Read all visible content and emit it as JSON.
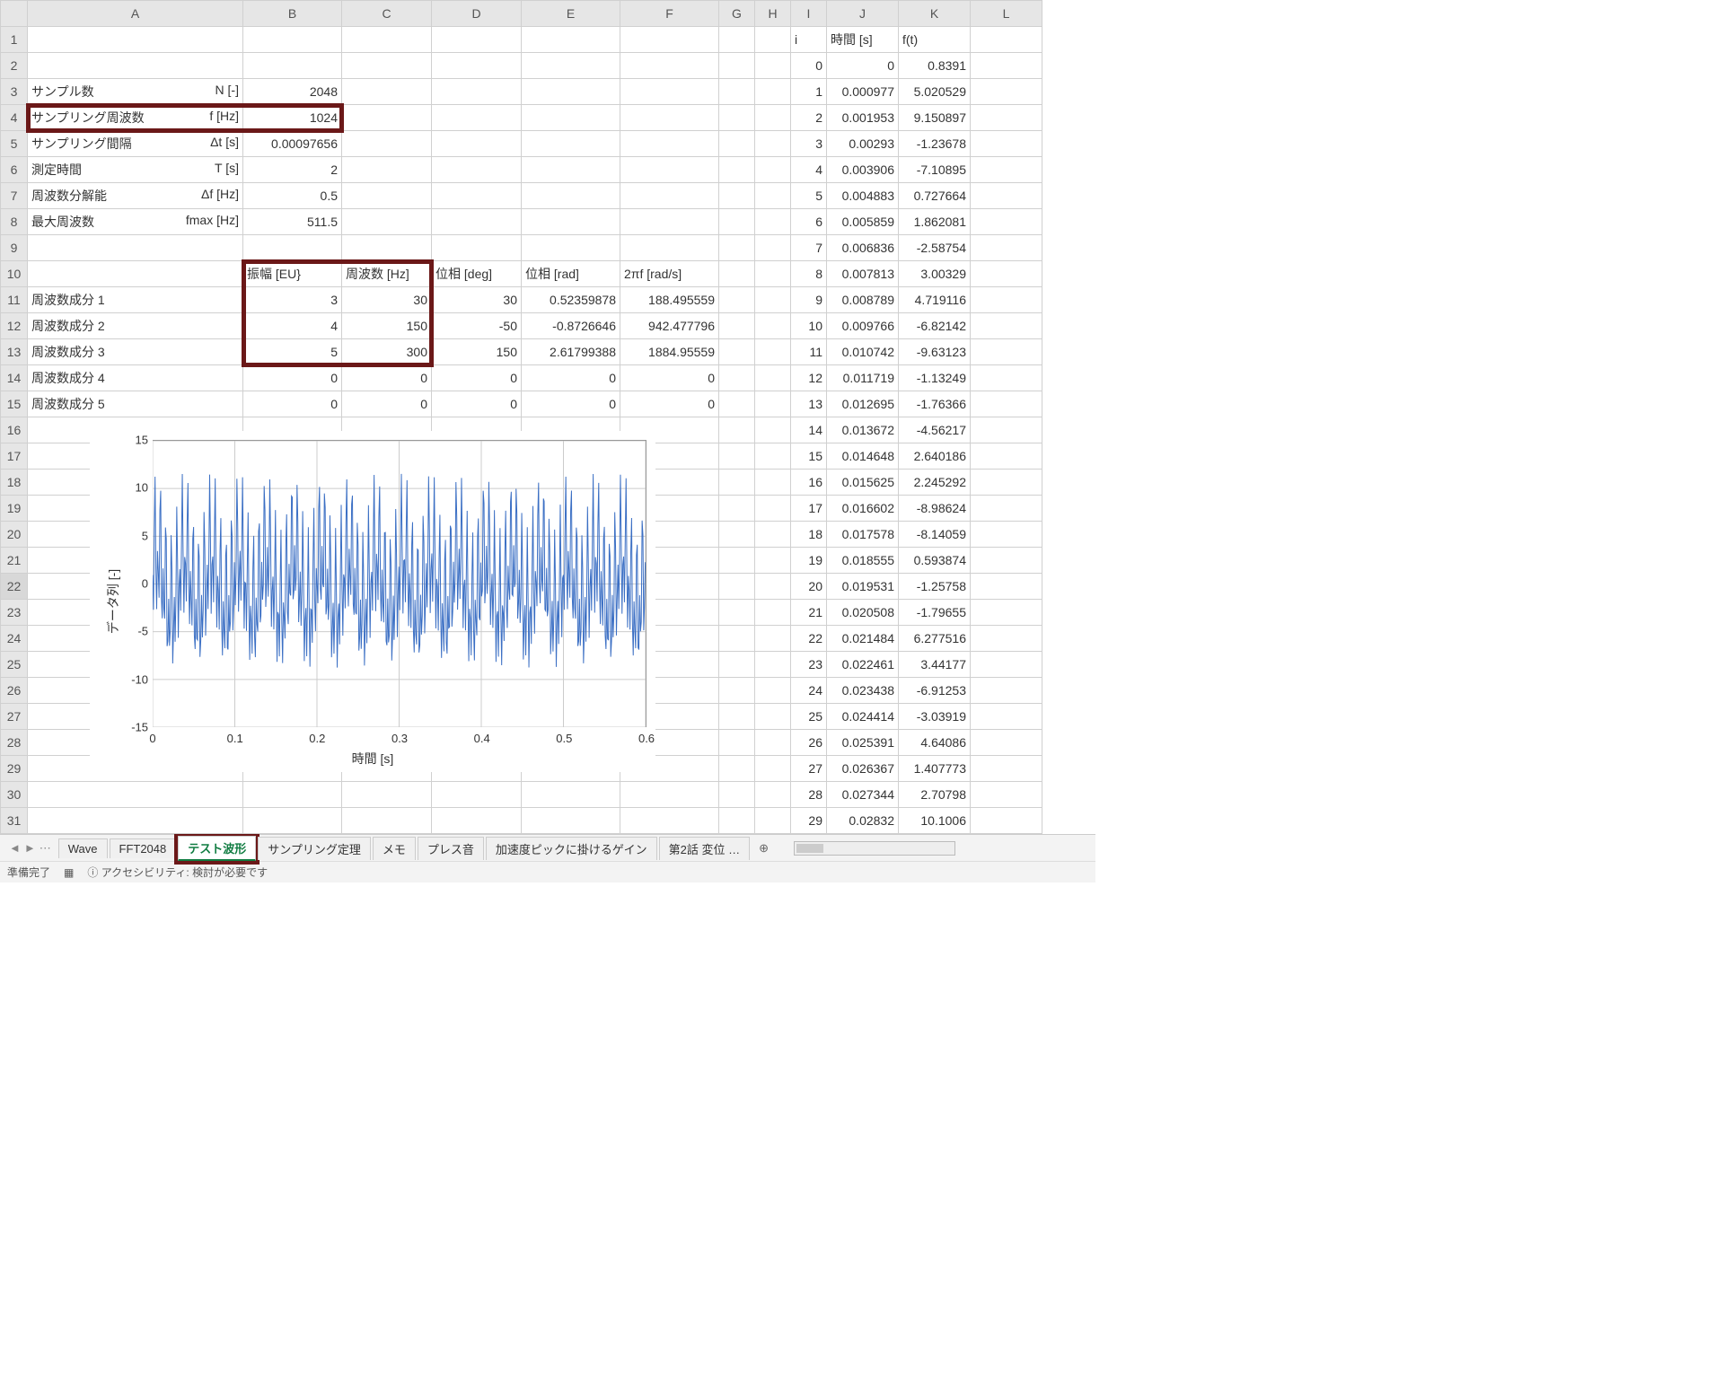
{
  "columns": [
    "A",
    "B",
    "C",
    "D",
    "E",
    "F",
    "G",
    "H",
    "I",
    "J",
    "K",
    "L"
  ],
  "row_count": 31,
  "params_header_row": 2,
  "params": [
    {
      "row": 3,
      "label": "サンプル数",
      "sym": "N [-]",
      "val": "2048"
    },
    {
      "row": 4,
      "label": "サンプリング周波数",
      "sym": "f [Hz]",
      "val": "1024",
      "hot": true
    },
    {
      "row": 5,
      "label": "サンプリング間隔",
      "sym": "Δt [s]",
      "val": "0.00097656"
    },
    {
      "row": 6,
      "label": "測定時間",
      "sym": "T [s]",
      "val": "2"
    },
    {
      "row": 7,
      "label": "周波数分解能",
      "sym": "Δf [Hz]",
      "val": "0.5"
    },
    {
      "row": 8,
      "label": "最大周波数",
      "sym": "fmax [Hz]",
      "val": "511.5"
    }
  ],
  "comp_header": {
    "row": 10,
    "B": "振幅 [EU}",
    "C": "周波数 [Hz]",
    "D": "位相 [deg]",
    "E": "位相 [rad]",
    "F": "2πf [rad/s]"
  },
  "components": [
    {
      "row": 11,
      "A": "周波数成分 1",
      "B": "3",
      "C": "30",
      "D": "30",
      "E": "0.52359878",
      "F": "188.495559"
    },
    {
      "row": 12,
      "A": "周波数成分 2",
      "B": "4",
      "C": "150",
      "D": "-50",
      "E": "-0.8726646",
      "F": "942.477796"
    },
    {
      "row": 13,
      "A": "周波数成分 3",
      "B": "5",
      "C": "300",
      "D": "150",
      "E": "2.61799388",
      "F": "1884.95559"
    },
    {
      "row": 14,
      "A": "周波数成分 4",
      "B": "0",
      "C": "0",
      "D": "0",
      "E": "0",
      "F": "0"
    },
    {
      "row": 15,
      "A": "周波数成分 5",
      "B": "0",
      "C": "0",
      "D": "0",
      "E": "0",
      "F": "0"
    }
  ],
  "comp_hot_rows": [
    10,
    11,
    12,
    13
  ],
  "data_header": {
    "row": 1,
    "I": "i",
    "J": "時間 [s]",
    "K": "f(t)"
  },
  "data_rows": [
    {
      "row": 2,
      "I": "0",
      "J": "0",
      "K": "0.8391"
    },
    {
      "row": 3,
      "I": "1",
      "J": "0.000977",
      "K": "5.020529"
    },
    {
      "row": 4,
      "I": "2",
      "J": "0.001953",
      "K": "9.150897"
    },
    {
      "row": 5,
      "I": "3",
      "J": "0.00293",
      "K": "-1.23678"
    },
    {
      "row": 6,
      "I": "4",
      "J": "0.003906",
      "K": "-7.10895"
    },
    {
      "row": 7,
      "I": "5",
      "J": "0.004883",
      "K": "0.727664"
    },
    {
      "row": 8,
      "I": "6",
      "J": "0.005859",
      "K": "1.862081"
    },
    {
      "row": 9,
      "I": "7",
      "J": "0.006836",
      "K": "-2.58754"
    },
    {
      "row": 10,
      "I": "8",
      "J": "0.007813",
      "K": "3.00329"
    },
    {
      "row": 11,
      "I": "9",
      "J": "0.008789",
      "K": "4.719116"
    },
    {
      "row": 12,
      "I": "10",
      "J": "0.009766",
      "K": "-6.82142"
    },
    {
      "row": 13,
      "I": "11",
      "J": "0.010742",
      "K": "-9.63123"
    },
    {
      "row": 14,
      "I": "12",
      "J": "0.011719",
      "K": "-1.13249"
    },
    {
      "row": 15,
      "I": "13",
      "J": "0.012695",
      "K": "-1.76366"
    },
    {
      "row": 16,
      "I": "14",
      "J": "0.013672",
      "K": "-4.56217"
    },
    {
      "row": 17,
      "I": "15",
      "J": "0.014648",
      "K": "2.640186"
    },
    {
      "row": 18,
      "I": "16",
      "J": "0.015625",
      "K": "2.245292"
    },
    {
      "row": 19,
      "I": "17",
      "J": "0.016602",
      "K": "-8.98624"
    },
    {
      "row": 20,
      "I": "18",
      "J": "0.017578",
      "K": "-8.14059"
    },
    {
      "row": 21,
      "I": "19",
      "J": "0.018555",
      "K": "0.593874"
    },
    {
      "row": 22,
      "I": "20",
      "J": "0.019531",
      "K": "-1.25758"
    },
    {
      "row": 23,
      "I": "21",
      "J": "0.020508",
      "K": "-1.79655"
    },
    {
      "row": 24,
      "I": "22",
      "J": "0.021484",
      "K": "6.277516"
    },
    {
      "row": 25,
      "I": "23",
      "J": "0.022461",
      "K": "3.44177"
    },
    {
      "row": 26,
      "I": "24",
      "J": "0.023438",
      "K": "-6.91253"
    },
    {
      "row": 27,
      "I": "25",
      "J": "0.024414",
      "K": "-3.03919"
    },
    {
      "row": 28,
      "I": "26",
      "J": "0.025391",
      "K": "4.64086"
    },
    {
      "row": 29,
      "I": "27",
      "J": "0.026367",
      "K": "1.407773"
    },
    {
      "row": 30,
      "I": "28",
      "J": "0.027344",
      "K": "2.70798"
    },
    {
      "row": 31,
      "I": "29",
      "J": "0.02832",
      "K": "10.1006"
    }
  ],
  "chart_data": {
    "type": "line",
    "ylabel": "データ列 [-]",
    "xlabel": "時間 [s]",
    "xlim": [
      0,
      0.6
    ],
    "ylim": [
      -15,
      15
    ],
    "xticks": [
      0,
      0.1,
      0.2,
      0.3,
      0.4,
      0.5,
      0.6
    ],
    "yticks": [
      -15,
      -10,
      -5,
      0,
      5,
      10,
      15
    ],
    "series": [
      {
        "name": "f(t)",
        "color": "#3b6fc4",
        "formula": "3*sin(2π·30·t+0.5236)+4*sin(2π·150·t-0.8727)+5*sin(2π·300·t+2.6180)",
        "dt": 0.00097656,
        "n": 615
      }
    ]
  },
  "tabs": [
    "Wave",
    "FFT2048",
    "テスト波形",
    "サンプリング定理",
    "メモ",
    "プレス音",
    "加速度ピックに掛けるゲイン",
    "第2話 変位 …"
  ],
  "active_tab": "テスト波形",
  "hot_tab": "テスト波形",
  "status": {
    "ready": "準備完了",
    "acc_label": "アクセシビリティ: 検討が必要です"
  },
  "selected_row": 22
}
